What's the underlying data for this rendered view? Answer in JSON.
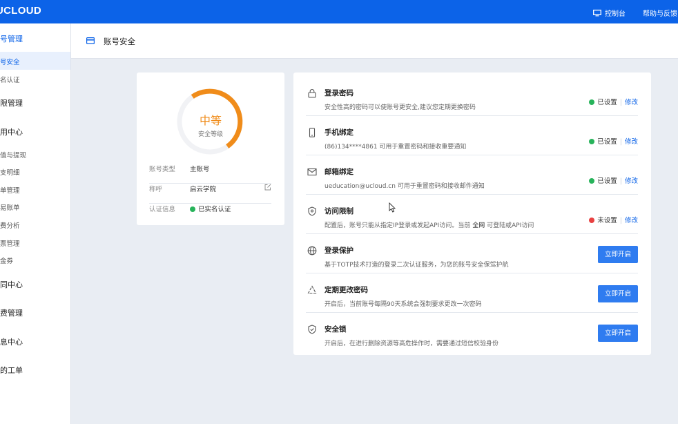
{
  "topbar": {
    "logo": "UCLOUD",
    "console": "控制台",
    "help": "帮助与反馈"
  },
  "sidebar": {
    "items": [
      {
        "label": "号管理",
        "type": "section",
        "active": true
      },
      {
        "label": "号安全",
        "type": "sub",
        "active": true
      },
      {
        "label": "名认证",
        "type": "sub"
      },
      {
        "label": "限管理",
        "type": "section"
      },
      {
        "label": "用中心",
        "type": "section"
      },
      {
        "label": "值与提现",
        "type": "sub"
      },
      {
        "label": "支明细",
        "type": "sub"
      },
      {
        "label": "单管理",
        "type": "sub"
      },
      {
        "label": "易账单",
        "type": "sub"
      },
      {
        "label": "费分析",
        "type": "sub"
      },
      {
        "label": "票管理",
        "type": "sub"
      },
      {
        "label": "金券",
        "type": "sub"
      },
      {
        "label": "同中心",
        "type": "section"
      },
      {
        "label": "费管理",
        "type": "section"
      },
      {
        "label": "息中心",
        "type": "section"
      },
      {
        "label": "的工单",
        "type": "section"
      }
    ]
  },
  "page": {
    "title": "账号安全"
  },
  "summary": {
    "level": "中等",
    "level_label": "安全等级",
    "level_fraction": 0.5,
    "account_type_key": "账号类型",
    "account_type": "主账号",
    "nickname_key": "称呼",
    "nickname": "启云学院",
    "cert_key": "认证信息",
    "cert_value": "已实名认证"
  },
  "security": {
    "items": [
      {
        "icon": "lock-icon",
        "title": "登录密码",
        "desc": "安全性高的密码可以使账号更安全,建议您定期更换密码",
        "status": "已设置",
        "status_color": "green",
        "action": "修改"
      },
      {
        "icon": "phone-icon",
        "title": "手机绑定",
        "desc": "(86)134****4861 可用于重置密码和接收重要通知",
        "status": "已设置",
        "status_color": "green",
        "action": "修改"
      },
      {
        "icon": "mail-icon",
        "title": "邮箱绑定",
        "desc": "ueducation@ucloud.cn 可用于重置密码和接收邮件通知",
        "status": "已设置",
        "status_color": "green",
        "action": "修改"
      },
      {
        "icon": "shield-check-icon",
        "title": "访问限制",
        "desc_prefix": "配置后，账号只能从指定IP登录或发起API访问。当前",
        "desc_highlight": "全网",
        "desc_suffix": "可登陆或API访问",
        "status": "未设置",
        "status_color": "red",
        "action": "修改"
      },
      {
        "icon": "globe-icon",
        "title": "登录保护",
        "desc": "基于TOTP技术打造的登录二次认证服务，为您的账号安全保驾护航",
        "button": "立即开启"
      },
      {
        "icon": "cycle-triangle-icon",
        "title": "定期更改密码",
        "desc": "开启后，当前账号每隔90天系统会强制要求更改一次密码",
        "button": "立即开启"
      },
      {
        "icon": "shield-lock-icon",
        "title": "安全锁",
        "desc": "开启后，在进行删除资源等高危操作时，需要通过短信校验身份",
        "button": "立即开启"
      }
    ]
  },
  "colors": {
    "brand": "#0c63e8",
    "gauge": "#f08c1a",
    "ok": "#27b35a",
    "warn": "#e84040"
  }
}
